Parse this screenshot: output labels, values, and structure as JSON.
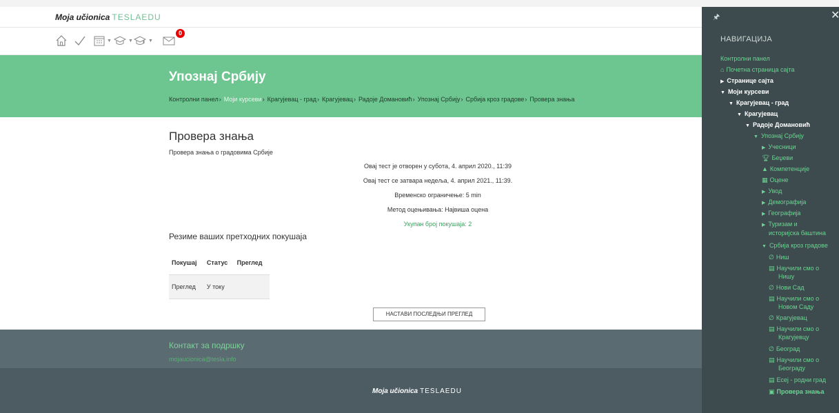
{
  "header": {
    "logo_left": "Moja učionica",
    "logo_right": "TESLAEDU"
  },
  "toolbar": {
    "icons": [
      "home-icon",
      "check-icon",
      "calendar-icon",
      "graduation-cap-icon",
      "graduation-cap-list-icon",
      "mail-icon"
    ],
    "mail_badge": "0"
  },
  "course": {
    "title": "Упознај Србију",
    "breadcrumb": [
      "Контролни панел",
      "Моји курсеви",
      "Крагујевац - град",
      "Крагујевац",
      "Радоје Домановић",
      "Упознај Србију",
      "Србија кроз градове",
      "Провера знања"
    ]
  },
  "quiz": {
    "title": "Провера знања",
    "intro": "Провера знања о градовима Србије",
    "opened": "Овај тест је отворен у субота, 4. април 2020., 11:39",
    "closes": "Овај тест се затвара недеља, 4. април 2021., 11:39.",
    "time_limit": "Временско ограничење: 5 min",
    "grading": "Метод оцењивања: Највиша оцена",
    "attempts_total": "Укупан број покушаја: 2",
    "summary_title": "Резиме ваших претходних покушаја",
    "table": {
      "headers": [
        "Покушај",
        "Статус",
        "Преглед"
      ],
      "rows": [
        [
          "Преглед",
          "У току",
          ""
        ]
      ]
    },
    "continue_button": "НАСТАВИ ПОСЛЕДЊИ ПРЕГЛЕД"
  },
  "footer": {
    "support_title": "Контакт за подршку",
    "support_email": "mojaucionica@tesla.info",
    "logo_left": "Moja učionica",
    "logo_right": "TESLAEDU"
  },
  "drawer": {
    "title": "НАВИГАЦИЈА",
    "items": [
      {
        "label": "Контролни панел"
      },
      {
        "label": "Почетна страница сајта"
      },
      {
        "label": "Странице сајта"
      },
      {
        "label": "Моји курсеви"
      },
      {
        "label": "Крагујевац - град"
      },
      {
        "label": "Крагујевац"
      },
      {
        "label": "Радоје Домановић"
      },
      {
        "label": "Упознај Србију"
      },
      {
        "label": "Учесници"
      },
      {
        "label": "Беџеви"
      },
      {
        "label": "Компетенције"
      },
      {
        "label": "Оцене"
      },
      {
        "label": "Увод"
      },
      {
        "label": "Демографија"
      },
      {
        "label": "Географија"
      },
      {
        "label": "Туризам и"
      },
      {
        "label": "историјска баштина"
      },
      {
        "label": "Србија кроз градове"
      },
      {
        "label": "Ниш"
      },
      {
        "label": "Научили смо о"
      },
      {
        "label": "Нишу"
      },
      {
        "label": "Нови Сад"
      },
      {
        "label": "Научили смо о"
      },
      {
        "label": "Новом Саду"
      },
      {
        "label": "Крагујевац"
      },
      {
        "label": "Научили смо о"
      },
      {
        "label": "Крагујевцу"
      },
      {
        "label": "Београд"
      },
      {
        "label": "Научили смо о"
      },
      {
        "label": "Београду"
      },
      {
        "label": "Есеј - родни град"
      },
      {
        "label": "Провера знања"
      }
    ]
  }
}
